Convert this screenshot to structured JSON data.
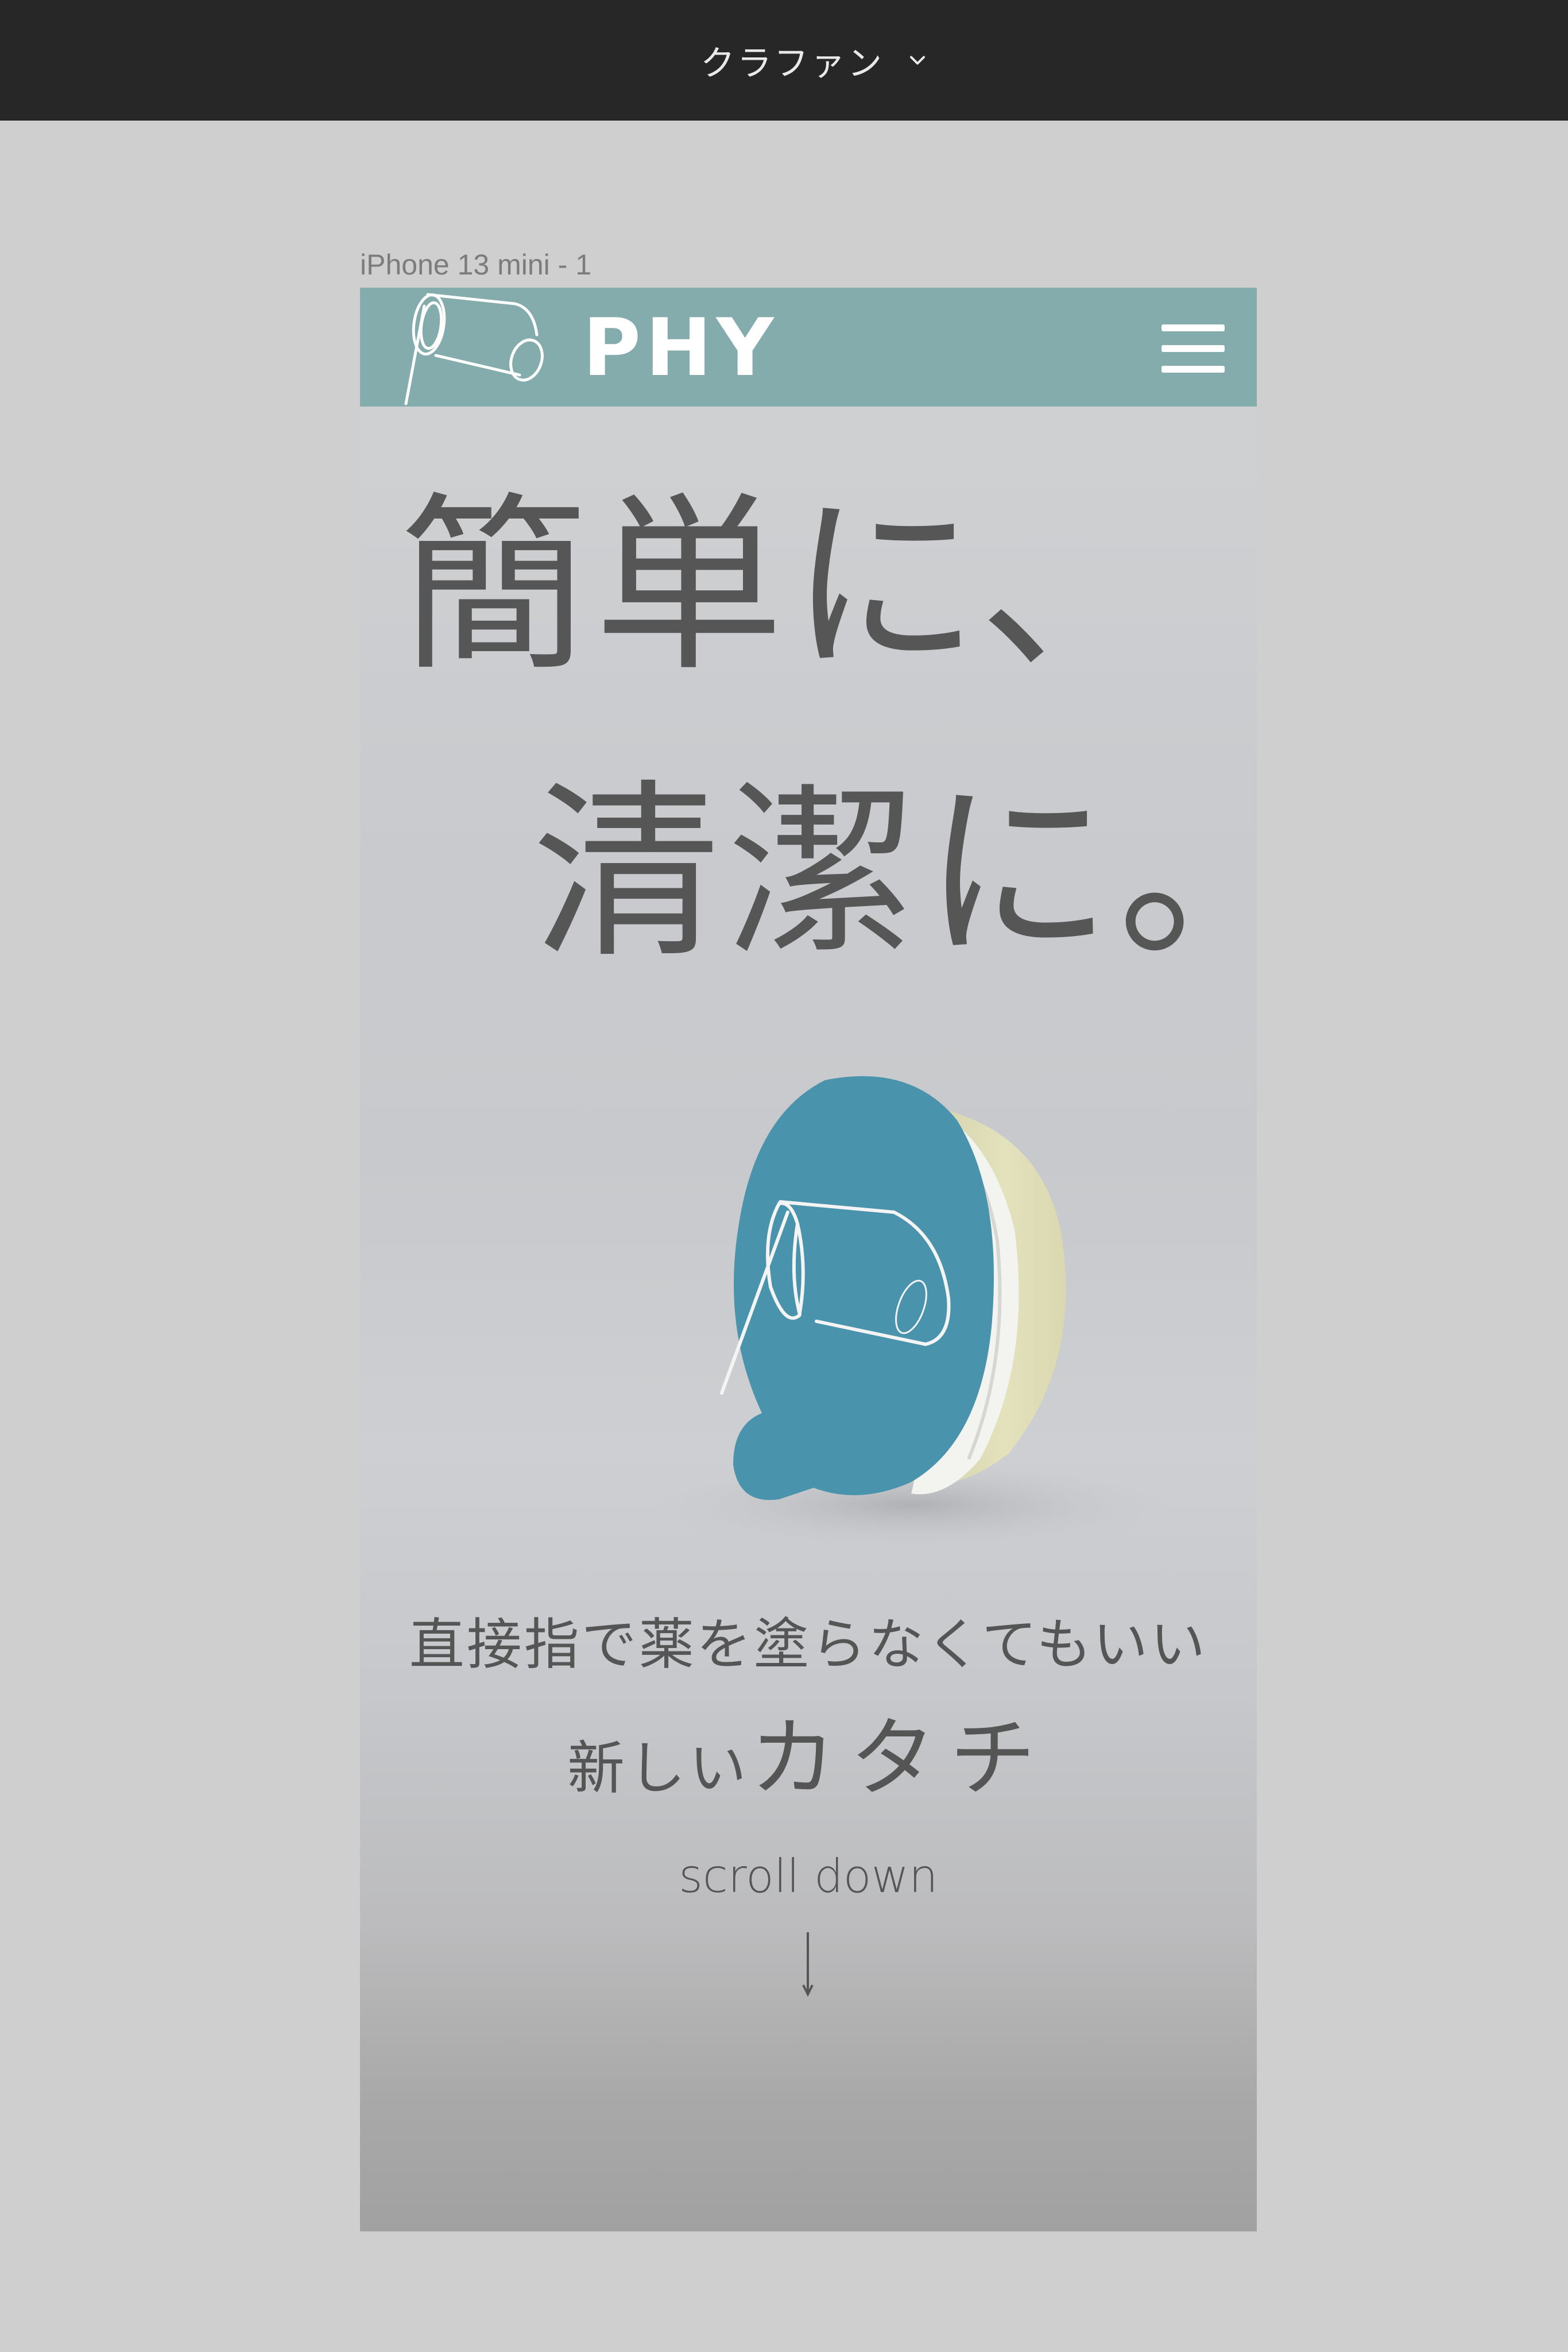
{
  "toolbar": {
    "project_name": "クラファン",
    "dropdown_icon": "chevron-down-icon"
  },
  "frame": {
    "label": "iPhone 13 mini - 1"
  },
  "header": {
    "brand": "PHY",
    "logo_icon": "phy-logo-icon",
    "menu_icon": "hamburger-menu-icon",
    "background": "#84acac"
  },
  "hero": {
    "headline_line1": "簡単に、",
    "headline_line2": "清潔に。",
    "product_image": "product-applicator-image",
    "product_color": "#4a93ad",
    "tagline_line1": "直接指で薬を塗らなくてもいい",
    "tagline_line2_prefix": "新しい",
    "tagline_line2_emphasis": "カタチ",
    "scroll_label": "scroll down",
    "scroll_icon": "arrow-down-icon"
  }
}
